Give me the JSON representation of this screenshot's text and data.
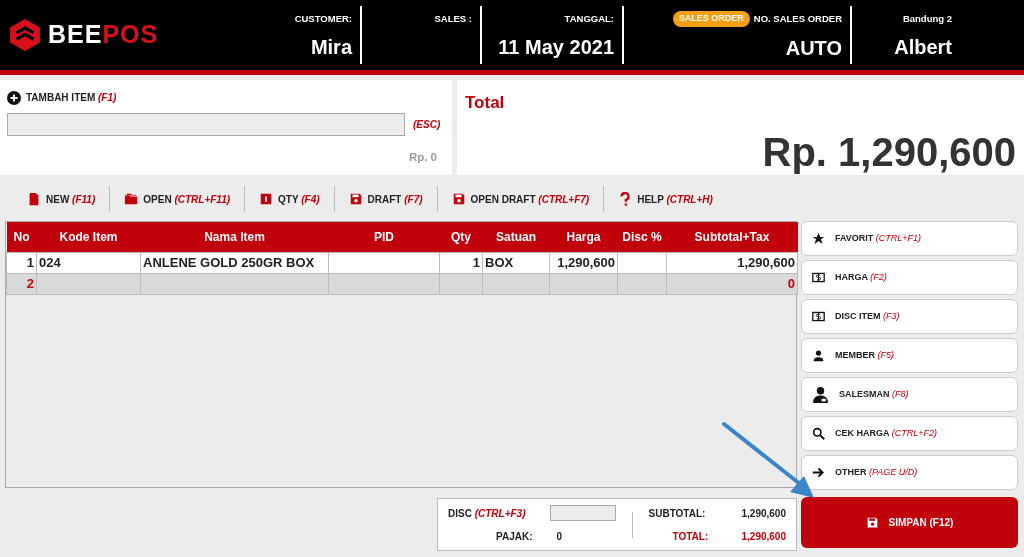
{
  "header": {
    "logo": {
      "part_1": "BEE",
      "part_2": "POS"
    },
    "fields": [
      {
        "label": "CUSTOMER:",
        "value": "Mira"
      },
      {
        "label": "SALES :"
      },
      {
        "label": "TANGGAL:",
        "value": "11 May 2021"
      },
      {
        "badge": "SALES ORDER",
        "label": "NO. SALES ORDER",
        "value": "AUTO"
      },
      {
        "label": "Bandung 2",
        "value": "Albert"
      }
    ]
  },
  "add_item": {
    "label": "TAMBAH ITEM",
    "shortcut": "(F1)",
    "clear_shortcut": "(ESC)",
    "price": "Rp. 0"
  },
  "total": {
    "label": "Total",
    "value": "Rp. 1,290,600"
  },
  "toolbar": [
    {
      "kind": "new",
      "label": "NEW",
      "shortcut": "(F11)"
    },
    {
      "kind": "open",
      "label": "OPEN",
      "shortcut": "(CTRL+F11)"
    },
    {
      "kind": "qty",
      "label": "QTY",
      "shortcut": "(F4)"
    },
    {
      "kind": "draft",
      "label": "DRAFT",
      "shortcut": "(F7)"
    },
    {
      "kind": "draft",
      "label": "OPEN DRAFT",
      "shortcut": "(CTRL+F7)"
    },
    {
      "kind": "help",
      "label": "HELP",
      "shortcut": "(CTRL+H)"
    }
  ],
  "table": {
    "columns": [
      "No",
      "Kode Item",
      "Nama Item",
      "PID",
      "Qty",
      "Satuan",
      "Harga",
      "Disc %",
      "Subtotal+Tax"
    ],
    "rows": [
      {
        "selected": false,
        "cells": [
          "1",
          "024",
          "ANLENE GOLD 250GR BOX",
          null,
          "1",
          "BOX",
          "1,290,600",
          null,
          "1,290,600"
        ]
      },
      {
        "selected": true,
        "cells": [
          "2",
          null,
          null,
          null,
          null,
          null,
          null,
          null,
          "0"
        ]
      }
    ]
  },
  "side_buttons": [
    {
      "kind": "star",
      "label": "FAVORIT",
      "shortcut": "(CTRL+F1)"
    },
    {
      "kind": "money",
      "label": "HARGA",
      "shortcut": "(F2)"
    },
    {
      "kind": "money",
      "label": "DISC ITEM",
      "shortcut": "(F3)"
    },
    {
      "kind": "person",
      "label": "MEMBER",
      "shortcut": "(F5)"
    },
    {
      "kind": "salesman",
      "label": "SALESMAN",
      "shortcut": "(F8)"
    },
    {
      "kind": "search",
      "label": "CEK HARGA",
      "shortcut": "(CTRL+F2)"
    },
    {
      "kind": "arrow",
      "label": "OTHER",
      "shortcut": "(PAGE U/D)"
    }
  ],
  "summary": {
    "disc_label": "DISC",
    "disc_shortcut": "(CTRL+F3)",
    "tax_label": "PAJAK:",
    "tax": "0",
    "subtotal_label": "SUBTOTAL:",
    "subtotal": "1,290,600",
    "total_label": "TOTAL:",
    "total": "1,290,600"
  },
  "save_button": {
    "label": "SIMPAN (F12)"
  }
}
